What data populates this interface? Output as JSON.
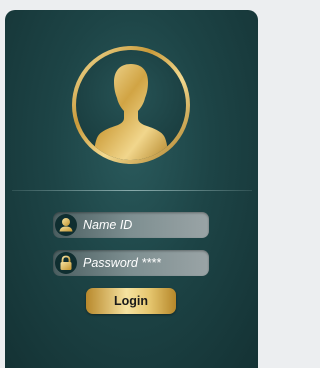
{
  "login_form": {
    "username_placeholder": "Name ID",
    "password_placeholder": "Password ****",
    "login_label": "Login",
    "username_icon": "user-icon",
    "password_icon": "lock-icon",
    "avatar_icon": "person-silhouette-icon"
  },
  "colors": {
    "card_background": "#1d4446",
    "gold_accent": "#d4aa4e",
    "field_background": "#7e8f91",
    "icon_background": "#0f2e30"
  }
}
